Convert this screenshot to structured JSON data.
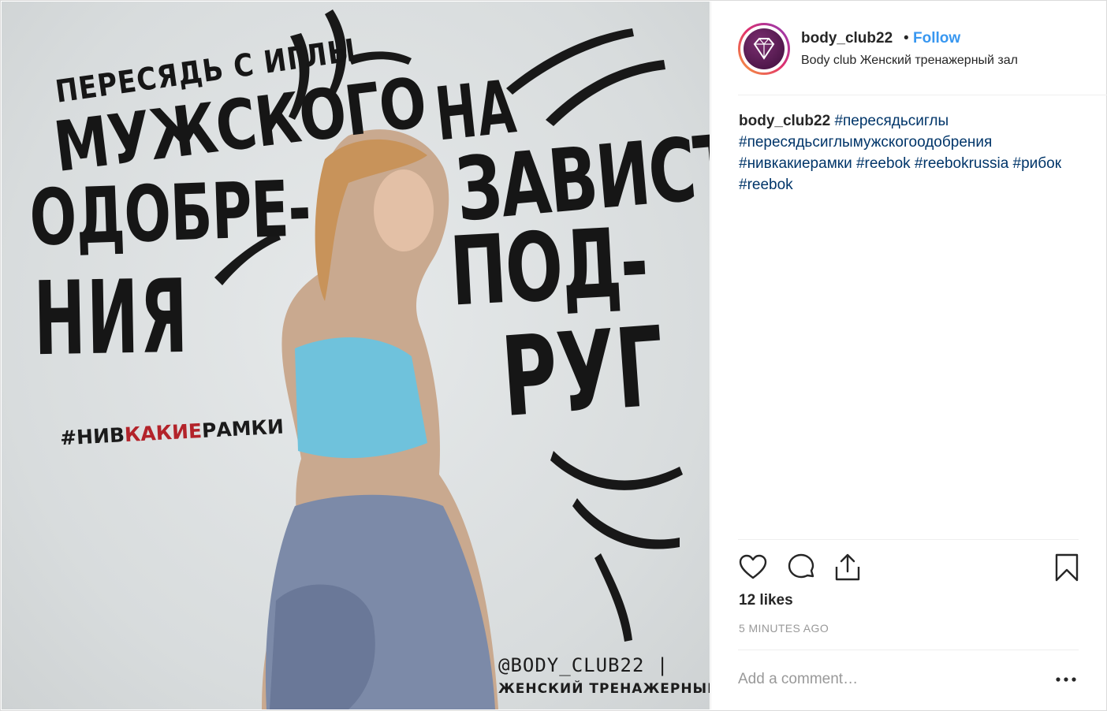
{
  "poster": {
    "left_lines": [
      "ПЕРЕСЯДЬ С ИГЛЫ",
      "МУЖСКОГО",
      "ОДОБРЕ-",
      "НИЯ"
    ],
    "right_lines": [
      "НА",
      "ЗАВИСТЬ",
      "ПОД-",
      "РУГ"
    ],
    "hashtag_prefix": "#НИВ",
    "hashtag_red": "КАКИЕ",
    "hashtag_suffix": "РАМКИ",
    "handle": "@BODY_CLUB22 |",
    "subhandle": "ЖЕНСКИЙ ТРЕНАЖЕРНЫЙ ЗАЛ"
  },
  "header": {
    "username": "body_club22",
    "separator": "•",
    "follow_label": "Follow",
    "location": "Body club Женский тренажерный зал"
  },
  "caption": {
    "username": "body_club22",
    "tags": [
      "#пересядьсиглы",
      "#пересядьсиглымужскогоодобрения",
      "#нивкакиерамки",
      "#reebok",
      "#reebokrussia",
      "#рибок",
      "#reebok"
    ]
  },
  "actions": {
    "icons": [
      "heart-icon",
      "comment-icon",
      "share-icon",
      "bookmark-icon"
    ]
  },
  "likes": "12 likes",
  "time": "5 MINUTES AGO",
  "comment": {
    "placeholder": "Add a comment…"
  },
  "colors": {
    "link": "#3897f0",
    "hashtag": "#003569",
    "red_accent": "#b3232a"
  }
}
